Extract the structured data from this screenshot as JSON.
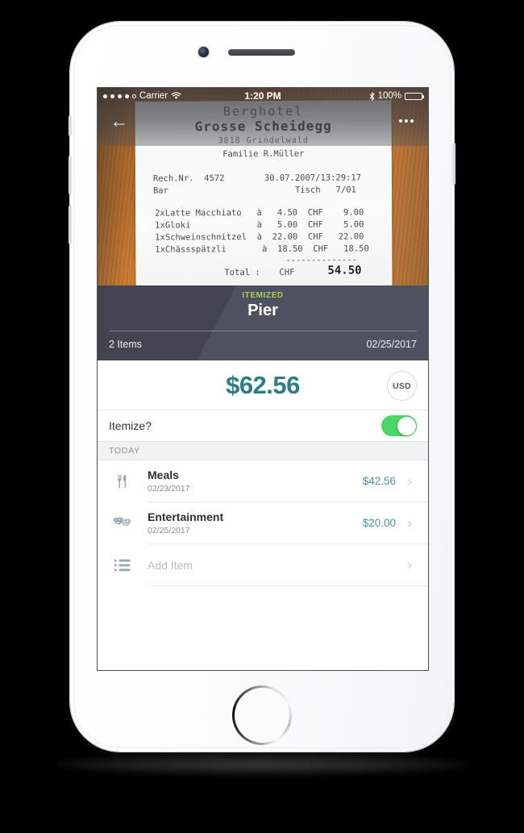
{
  "status_bar": {
    "carrier": "Carrier",
    "time": "1:20 PM",
    "battery_pct": "100%",
    "signal_dots_filled": 4,
    "signal_dots_total": 5,
    "wifi_icon": "wifi-icon",
    "bluetooth_icon": "bluetooth-icon",
    "battery_icon": "battery-icon"
  },
  "nav": {
    "back_icon": "←",
    "more_icon": "ellipsis-icon"
  },
  "receipt_photo": {
    "merchant_line1": "Berghotel",
    "merchant_line2": "Grosse Scheidegg",
    "address": "3818 Grindelwald",
    "owner": "Familie R.Müller",
    "invoice_no": "Rech.Nr.  4572",
    "datetime": "30.07.2007/13:29:17",
    "payment_type": "Bar",
    "table": "Tisch   7/01",
    "items": [
      "2xLatte Macchiato   à   4.50  CHF    9.00",
      "1xGloki             à   5.00  CHF    5.00",
      "1xSchweinschnitzel  à  22.00  CHF   22.00",
      "1xChässspätzli       à  18.50  CHF   18.50"
    ],
    "divider": "--------------",
    "total_label": "Total :",
    "total_currency": "CHF",
    "total_value": "54.50"
  },
  "header": {
    "badge": "ITEMIZED",
    "title": "Pier",
    "item_count": "2 Items",
    "date": "02/25/2017"
  },
  "amount_section": {
    "total": "$62.56",
    "currency": "USD"
  },
  "itemize": {
    "label": "Itemize?",
    "toggle_on": true
  },
  "section": {
    "today_label": "TODAY"
  },
  "list": {
    "rows": [
      {
        "icon": "meals-icon",
        "title": "Meals",
        "date": "02/23/2017",
        "amount": "$42.56",
        "chevron": "›"
      },
      {
        "icon": "entertainment-icon",
        "title": "Entertainment",
        "date": "02/25/2017",
        "amount": "$20.00",
        "chevron": "›"
      },
      {
        "icon": "add-item-icon",
        "title": "Add Item",
        "date": "",
        "amount": "",
        "chevron": "›"
      }
    ]
  },
  "colors": {
    "accent_teal": "#2f7c86",
    "amount_teal": "#4f959d",
    "badge_green": "#a8cf4f",
    "toggle_green": "#4bd566",
    "header_dark": "#4e5160"
  }
}
